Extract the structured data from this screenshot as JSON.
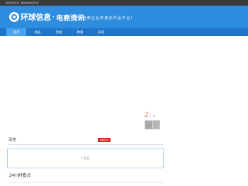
{
  "topbar": {
    "text": "电商运营周边，看企速电商咨讯站"
  },
  "header": {
    "logo_name": "环球信息",
    "logo_sep": "·",
    "logo_sub": "电商资讯",
    "slogan": "能建电商企业的成长伴侣平台!"
  },
  "nav": {
    "items": [
      {
        "label": "首页"
      },
      {
        "label": "动态"
      },
      {
        "label": "活动"
      },
      {
        "label": "政策"
      },
      {
        "label": "知识"
      }
    ]
  },
  "gallery": {
    "current": "2",
    "separator": "/",
    "total": "4"
  },
  "section": {
    "title": "动态",
    "badge": "电商资讯"
  },
  "ad": {
    "text": "广告位"
  },
  "hot": {
    "title": "24小时看点"
  },
  "colors": {
    "header_bg": "#2f8ddf",
    "nav_bg": "#1f76c9",
    "nav_active": "#4aa3ef",
    "badge_red": "#e02020",
    "counter_orange": "#d25a1e"
  }
}
